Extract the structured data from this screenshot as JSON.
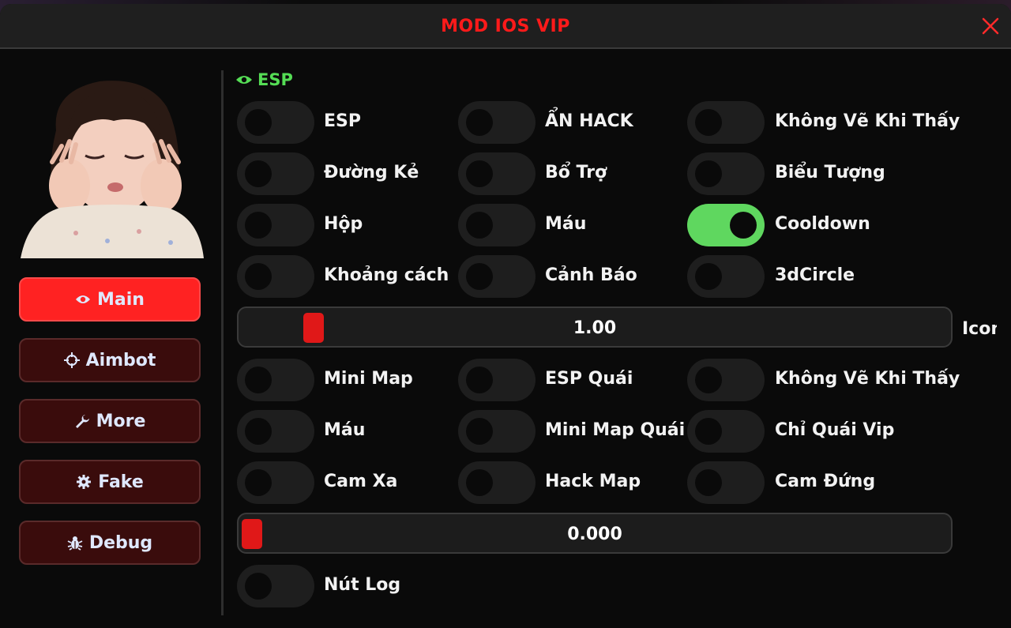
{
  "window": {
    "title": "MOD IOS VIP"
  },
  "nav": [
    {
      "label": "Main",
      "icon": "eye-icon",
      "active": true
    },
    {
      "label": "Aimbot",
      "icon": "crosshair-icon",
      "active": false
    },
    {
      "label": "More",
      "icon": "wrench-icon",
      "active": false
    },
    {
      "label": "Fake",
      "icon": "gear-icon",
      "active": false
    },
    {
      "label": "Debug",
      "icon": "bug-icon",
      "active": false
    }
  ],
  "section": {
    "title": "ESP",
    "icon": "eye-icon",
    "color": "#55dd55"
  },
  "toggles_group1": [
    {
      "label": "ESP",
      "on": false
    },
    {
      "label": "ẨN HACK",
      "on": false
    },
    {
      "label": "Không Vẽ Khi Thấy",
      "on": false
    },
    {
      "label": "Đường Kẻ",
      "on": false
    },
    {
      "label": "Bổ Trợ",
      "on": false
    },
    {
      "label": "Biểu Tượng",
      "on": false
    },
    {
      "label": "Hộp",
      "on": false
    },
    {
      "label": "Máu",
      "on": false
    },
    {
      "label": "Cooldown",
      "on": true
    },
    {
      "label": "Khoảng cách",
      "on": false
    },
    {
      "label": "Cảnh Báo",
      "on": false
    },
    {
      "label": "3dCircle",
      "on": false
    }
  ],
  "slider1": {
    "value_text": "1.00",
    "fraction": 0.09,
    "trailing_label": "Icon"
  },
  "toggles_group2": [
    {
      "label": "Mini Map",
      "on": false
    },
    {
      "label": "ESP Quái",
      "on": false
    },
    {
      "label": "Không Vẽ Khi Thấy",
      "on": false
    },
    {
      "label": "Máu",
      "on": false
    },
    {
      "label": "Mini Map Quái",
      "on": false
    },
    {
      "label": "Chỉ Quái Vip",
      "on": false
    },
    {
      "label": "Cam Xa",
      "on": false
    },
    {
      "label": "Hack Map",
      "on": false
    },
    {
      "label": "Cam Đứng",
      "on": false
    }
  ],
  "slider2": {
    "value_text": "0.000",
    "fraction": 0.0
  },
  "toggles_group3": [
    {
      "label": "Nút Log",
      "on": false
    }
  ],
  "colors": {
    "accent_red": "#ff2222",
    "title_red": "#ff1a1a",
    "toggle_on": "#5fd75f",
    "nav_bg": "#3a0c0c"
  }
}
